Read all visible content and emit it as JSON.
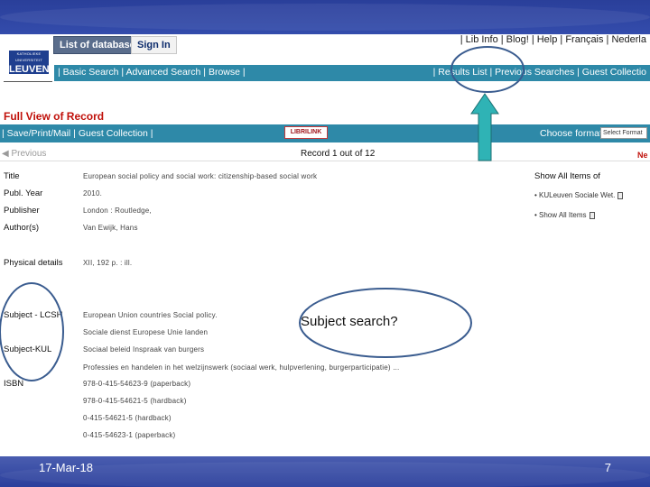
{
  "topbar": {
    "tab_databases": "List of databases",
    "tab_signin": "Sign In",
    "toplinks": "| Lib Info | Blog! | Help | Français | Nederla"
  },
  "logo": {
    "line1": "KATHOLIEKE UNIVERSITEIT",
    "line2": "LEUVEN"
  },
  "navbar": {
    "left": "| Basic Search | Advanced Search | Browse |",
    "right": "| Results List | Previous Searches | Guest Collectio"
  },
  "page": {
    "heading": "Full View of Record"
  },
  "formatbar": {
    "left": "| Save/Print/Mail | Guest Collection |",
    "librilink": "LIBRILINK",
    "choose_format": "Choose format",
    "format_value": "Select Format"
  },
  "record_nav": {
    "previous": "Previous",
    "record": "Record 1 out of 12",
    "next": "Ne"
  },
  "fields": {
    "title_label": "Title",
    "title_value": "European social policy and social work: citizenship-based social work",
    "year_label": "Publ. Year",
    "year_value": "2010.",
    "publisher_label": "Publisher",
    "publisher_value": "London : Routledge,",
    "author_label": "Author(s)",
    "author_value": "Van Ewijk, Hans",
    "physical_label": "Physical details",
    "physical_value": "XII, 192 p. : ill.",
    "lcsh_label": "Subject - LCSH",
    "lcsh_value": "European Union countries Social policy.",
    "kul_label": "Subject-KUL",
    "kul_value_1": "Sociale dienst Europese Unie landen",
    "kul_value_2": "Sociaal beleid Inspraak van burgers",
    "kul_value_3": "Professies en handelen in het welzijnswerk (sociaal werk, hulpverlening, burgerparticipatie) ...",
    "isbn_label": "ISBN",
    "isbn_1": "978-0-415-54623-9 (paperback)",
    "isbn_2": "978-0-415-54621-5 (hardback)",
    "isbn_3": "0-415-54621-5 (hardback)",
    "isbn_4": "0-415-54623-1 (paperback)"
  },
  "show_all": {
    "heading": "Show All Items of",
    "item1": "• KULeuven Sociale Wet.",
    "item2": "• Show All Items"
  },
  "annotations": {
    "callout": "Subject search?"
  },
  "footer": {
    "date": "17-Mar-18",
    "page_number": "7"
  },
  "colors": {
    "nav_teal": "#2e89a8",
    "heading_red": "#c0100a",
    "annotation_teal": "#2fb3b5",
    "annotation_ring": "#3a5c8f"
  }
}
